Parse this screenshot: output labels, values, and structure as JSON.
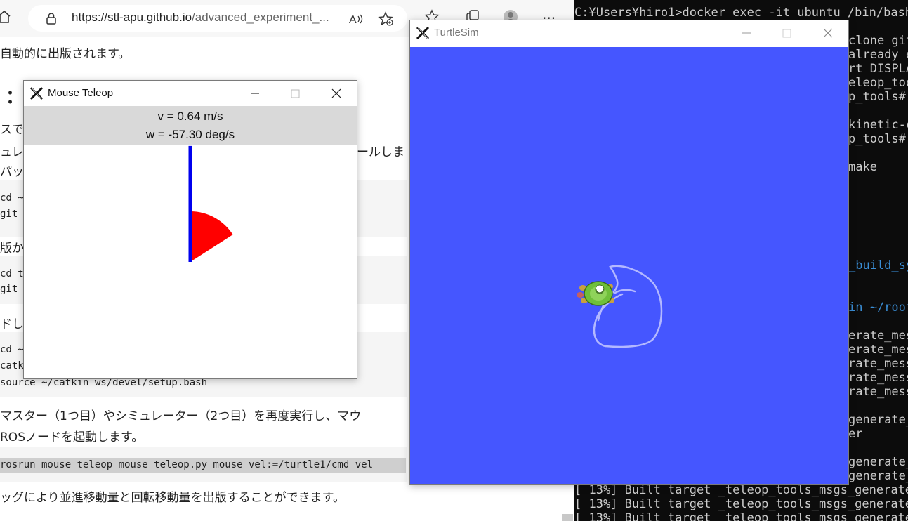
{
  "browser": {
    "url_main": "https://stl-apu.github.io",
    "url_rest": "/advanced_experiment_...",
    "icons": [
      "home-icon",
      "lock-icon",
      "read-aloud-icon",
      "favorite-icon",
      "favorites-bar-icon",
      "collections-icon",
      "profile-icon",
      "more-icon"
    ],
    "more_label": "...",
    "page_lines": {
      "line1": "自動的に出版されます。",
      "colon": "：",
      "frag_su": "スで",
      "frag_yu": "ュレ",
      "frag_pa": "パッ",
      "frag_install": "ールしま",
      "code1_a": "cd ~/",
      "code1_b": "git c",
      "frag_han": "版か",
      "code2_a": "cd to",
      "code2_b": "git c",
      "frag_do": "ドし",
      "code3_a": "cd ~/",
      "code3_b": "catki",
      "code3_c": "source ~/catkin_ws/devel/setup.bash",
      "para1": "マスター（1つ目）やシミュレーター（2つ目）を再度実行し、マウ",
      "para2": "ROSノードを起動します。",
      "command": "rosrun mouse_teleop mouse_teleop.py mouse_vel:=/turtle1/cmd_vel",
      "para3": "ッグにより並進移動量と回転移動量を出版することができます。"
    }
  },
  "terminal": {
    "lines": [
      "C:¥Users¥hiro1>docker exec -it ubuntu /bin/bash",
      "clone git",
      "already e",
      "rt DISPLA",
      "eleop_too",
      "p_tools#",
      "kinetic-c",
      "p_tools#",
      "make",
      "_build_sy",
      "in ~/root",
      "erate_mess",
      "erate_mess",
      "rate_mess",
      "rate_mess",
      "rate_mess",
      "generate_",
      "er",
      "generate_",
      "generate_",
      "[ 13%] Built target _teleop_tools_msgs_generate_",
      "[ 13%] Built target _teleop_tools_msgs_generate_",
      "[ 13%] Built target _teleop_tools_msgs_generate_"
    ]
  },
  "mouse_teleop": {
    "title": "Mouse Teleop",
    "linear_text": "v = 0.64 m/s",
    "angular_text": "w = -57.30 deg/s",
    "linear_value": 0.64,
    "angular_value_deg_s": -57.3,
    "colors": {
      "linear_bar": "#0000ee",
      "angular_wedge": "#ff0000",
      "status_bg": "#d9d9d9"
    }
  },
  "turtlesim": {
    "title": "TurtleSim",
    "colors": {
      "background": "#4556ff",
      "trail": "#b3b8ff",
      "turtle_shell": "#6fbf3a"
    }
  },
  "window_controls": {
    "minimize": "minimize-icon",
    "maximize": "maximize-icon",
    "close": "close-icon"
  }
}
